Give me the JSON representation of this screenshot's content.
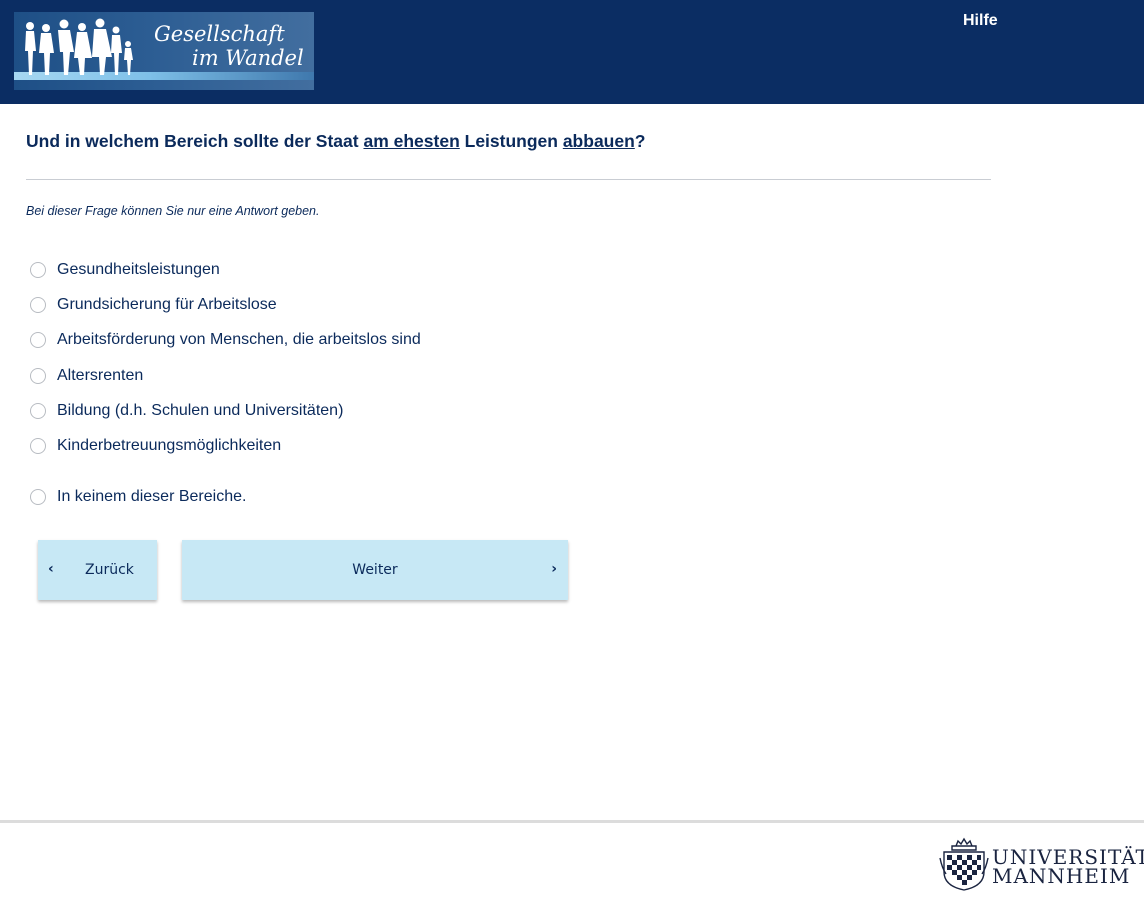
{
  "header": {
    "logo_line1": "Gesellschaft",
    "logo_line2": "im Wandel",
    "help_label": "Hilfe"
  },
  "question": {
    "part1": "Und in welchem Bereich sollte der Staat ",
    "emph1": "am ehesten",
    "part2": " Leistungen ",
    "emph2": "abbauen",
    "part3": "?"
  },
  "instruction": "Bei dieser Frage können Sie nur eine Antwort geben.",
  "options": [
    {
      "label": "Gesundheitsleistungen",
      "selected": false
    },
    {
      "label": "Grundsicherung für Arbeitslose",
      "selected": false
    },
    {
      "label": "Arbeitsförderung von Menschen, die arbeitslos sind",
      "selected": false
    },
    {
      "label": "Altersrenten",
      "selected": false
    },
    {
      "label": "Bildung (d.h. Schulen und Universitäten)",
      "selected": false
    },
    {
      "label": "Kinderbetreuungsmöglichkeiten",
      "selected": false
    },
    {
      "label": "In keinem dieser Bereiche.",
      "selected": false
    }
  ],
  "nav": {
    "back_label": "Zurück",
    "next_label": "Weiter",
    "back_icon": "chevron-left-icon",
    "next_icon": "chevron-right-icon"
  },
  "footer": {
    "uni_line1": "UNIVERSITÄT",
    "uni_line2": "MANNHEIM"
  },
  "colors": {
    "header_bg": "#0b2d63",
    "text": "#0b2a5b",
    "button_bg": "#c7e8f5"
  }
}
